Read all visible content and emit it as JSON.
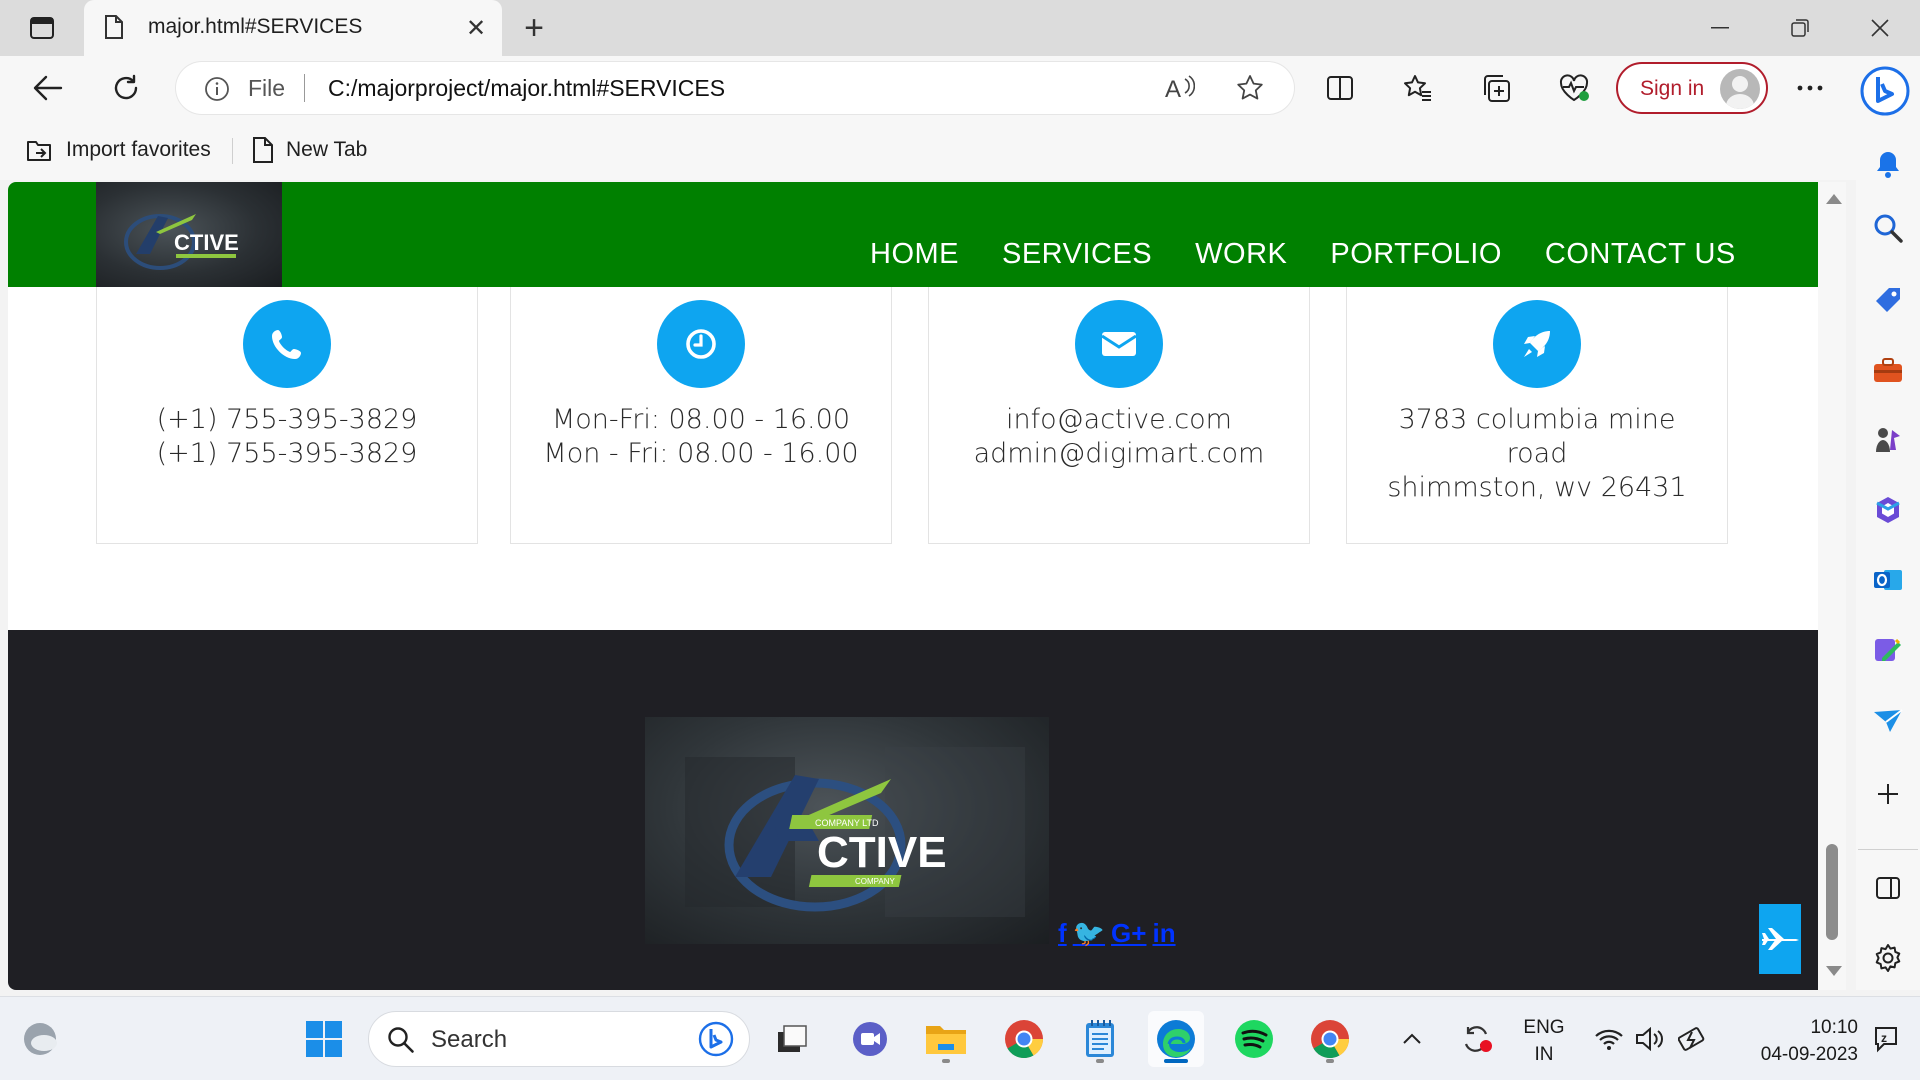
{
  "browser": {
    "tab_title": "major.html#SERVICES",
    "address_prefix": "File",
    "url": "C:/majorproject/major.html#SERVICES",
    "sign_in_label": "Sign in",
    "favorites": [
      {
        "label": "Import favorites",
        "icon": "import-favorites-icon"
      },
      {
        "label": "New Tab",
        "icon": "page-icon"
      }
    ]
  },
  "site": {
    "logo_text": "CTIVE",
    "logo_subtext": "COMPANY LTD",
    "nav": [
      "HOME",
      "SERVICES",
      "WORK",
      "PORTFOLIO",
      "CONTACT US"
    ],
    "contact_cards": [
      {
        "icon": "phone-icon",
        "lines": [
          "(+1) 755-395-3829",
          "(+1) 755-395-3829"
        ]
      },
      {
        "icon": "clock-icon",
        "lines": [
          "Mon-Fri: 08.00 - 16.00",
          "Mon - Fri: 08.00 - 16.00"
        ]
      },
      {
        "icon": "envelope-icon",
        "lines": [
          "info@active.com",
          "admin@digimart.com"
        ]
      },
      {
        "icon": "rocket-icon",
        "lines": [
          "3783 columbia mine",
          "road",
          "shimmston, wv 26431"
        ]
      }
    ],
    "footer_logo_text": "CTIVE",
    "footer_logo_sub_top": "COMPANY LTD",
    "footer_logo_sub_bottom": "COMPANY",
    "socials": [
      "f",
      "🐦",
      "G+",
      "in"
    ]
  },
  "taskbar": {
    "search_label": "Search",
    "language": "ENG",
    "region": "IN",
    "time": "10:10",
    "date": "04-09-2023"
  },
  "colors": {
    "nav_green": "#008000",
    "accent_blue": "#0ea5f0",
    "footer_dark": "#1f1f24",
    "social_blue": "#0033ff",
    "signin_red": "#b11d2c"
  }
}
